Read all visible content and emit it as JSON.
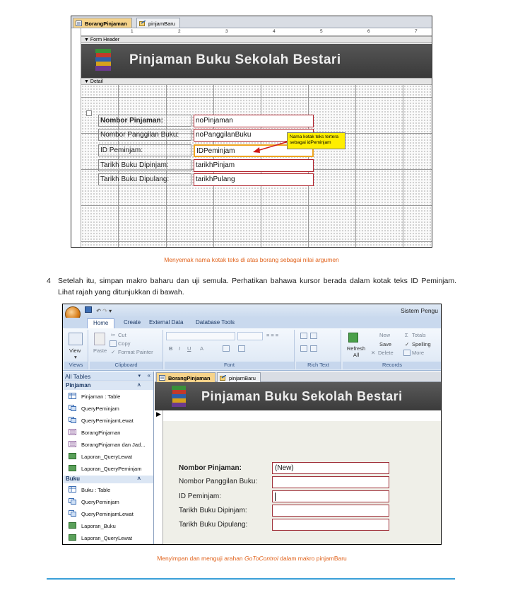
{
  "figure1": {
    "tabs": [
      "BorangPinjaman",
      "pinjamBaru"
    ],
    "ruler_numbers": [
      "1",
      "2",
      "3",
      "4",
      "5",
      "6",
      "7"
    ],
    "form_header_label": "Form Header",
    "detail_label": "Detail",
    "title": "Pinjaman Buku Sekolah Bestari",
    "fields": [
      {
        "label": "Nombor Pinjaman:",
        "value": "noPinjaman"
      },
      {
        "label": "Nombor Panggilan Buku:",
        "value": "noPanggilanBuku"
      },
      {
        "label": "ID Peminjam:",
        "value": "IDPeminjam"
      },
      {
        "label": "Tarikh Buku Dipinjam:",
        "value": "tarikhPinjam"
      },
      {
        "label": "Tarikh Buku Dipulang:",
        "value": "tarikhPulang"
      }
    ],
    "callout": "Nama kotak teks tertera sebagai idPeminjam",
    "caption": "Menyemak nama kotak teks di atas borang sebagai nilai argumen"
  },
  "instruction": {
    "number": "4",
    "text": "Setelah itu, simpan makro baharu dan uji semula. Perhatikan bahawa kursor berada dalam kotak teks ID Peminjam. Lihat rajah yang ditunjukkan di bawah."
  },
  "figure2": {
    "app_title": "Sistem Pengu",
    "ribbon_tabs": [
      "Home",
      "Create",
      "External Data",
      "Database Tools"
    ],
    "groups": {
      "views": "Views",
      "clipboard": "Clipboard",
      "font": "Font",
      "rich_text": "Rich Text",
      "records": "Records"
    },
    "buttons": {
      "view": "View",
      "paste": "Paste",
      "cut": "Cut",
      "copy": "Copy",
      "format_painter": "Format Painter",
      "refresh": "Refresh All",
      "new": "New",
      "save": "Save",
      "delete": "Delete",
      "totals": "Totals",
      "spelling": "Spelling",
      "more": "More"
    },
    "nav_header": "All Tables",
    "nav_groups": [
      {
        "name": "Pinjaman",
        "items": [
          "Pinjaman : Table",
          "QueryPeminjam",
          "QueryPeminjamLewat",
          "BorangPinjaman",
          "BorangPinjaman dan Jad...",
          "Laporan_QueryLewat",
          "Laporan_QueryPeminjam"
        ]
      },
      {
        "name": "Buku",
        "items": [
          "Buku : Table",
          "QueryPeminjam",
          "QueryPeminjamLewat",
          "Laporan_Buku",
          "Laporan_QueryLewat"
        ]
      }
    ],
    "form_tabs": [
      "BorangPinjaman",
      "pinjamBaru"
    ],
    "title": "Pinjaman Buku Sekolah Bestari",
    "fields": [
      {
        "label": "Nombor Pinjaman:",
        "value": "(New)"
      },
      {
        "label": "Nombor Panggilan Buku:",
        "value": ""
      },
      {
        "label": "ID Peminjam:",
        "value": ""
      },
      {
        "label": "Tarikh Buku Dipinjam:",
        "value": ""
      },
      {
        "label": "Tarikh Buku Dipulang:",
        "value": ""
      }
    ],
    "caption_prefix": "Menyimpan dan menguji arahan ",
    "caption_em": "GoToControl",
    "caption_suffix": " dalam makro pinjamBaru"
  },
  "colors": {
    "caption": "#e0611a",
    "rule": "#3a9fd8",
    "textbox_border": "#b0202a",
    "callout": "#ffee00"
  }
}
